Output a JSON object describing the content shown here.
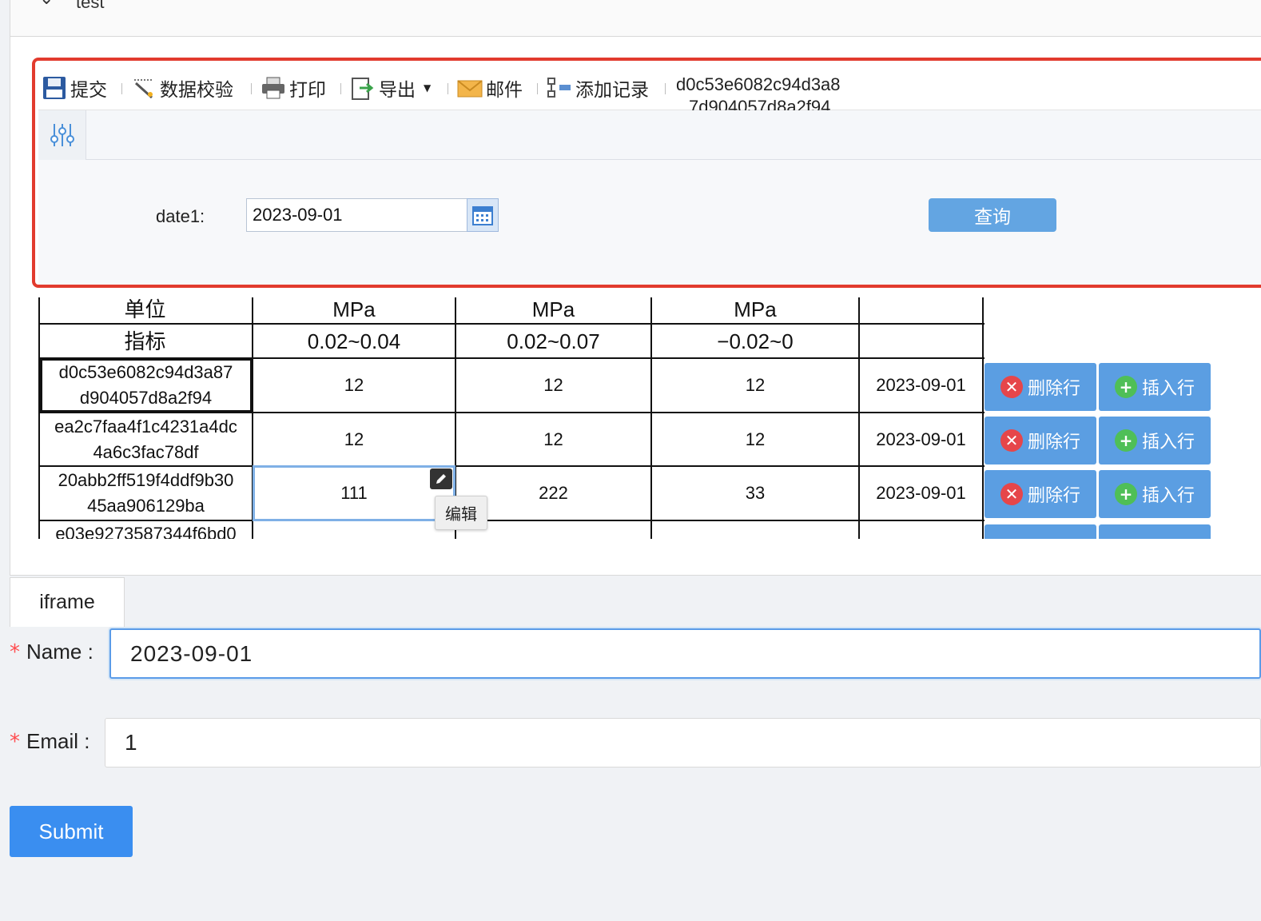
{
  "collapse": {
    "title": "test"
  },
  "toolbar": {
    "submit": "提交",
    "validate": "数据校验",
    "print": "打印",
    "export": "导出",
    "mail": "邮件",
    "add_record": "添加记录",
    "record_id_line1": "d0c53e6082c94d3a8",
    "record_id_line2": "7d904057d8a2f94"
  },
  "query": {
    "date_label": "date1:",
    "date_value": "2023-09-01",
    "search_button": "查询"
  },
  "table": {
    "unit_label": "单位",
    "metric_label": "指标",
    "units": [
      "MPa",
      "MPa",
      "MPa"
    ],
    "ranges": [
      "0.02~0.04",
      "0.02~0.07",
      "−0.02~0"
    ],
    "rows": [
      {
        "id1": "d0c53e6082c94d3a87",
        "id2": "d904057d8a2f94",
        "v1": "12",
        "v2": "12",
        "v3": "12",
        "date": "2023-09-01"
      },
      {
        "id1": "ea2c7faa4f1c4231a4dc",
        "id2": "4a6c3fac78df",
        "v1": "12",
        "v2": "12",
        "v3": "12",
        "date": "2023-09-01"
      },
      {
        "id1": "20abb2ff519f4ddf9b30",
        "id2": "45aa906129ba",
        "v1": "111",
        "v2": "222",
        "v3": "33",
        "date": "2023-09-01"
      },
      {
        "id1": "e03e9273587344f6bd0",
        "id2": "",
        "v1": "",
        "v2": "",
        "v3": "",
        "date": ""
      }
    ],
    "delete_row": "删除行",
    "insert_row": "插入行",
    "edit_tooltip": "编辑"
  },
  "tab": {
    "label": "iframe"
  },
  "form": {
    "name_label": "Name",
    "name_value": "2023-09-01",
    "email_label": "Email",
    "email_value": "1",
    "submit_label": "Submit"
  },
  "colors": {
    "accent": "#3a8ef0",
    "highlight": "#e23b2e",
    "delete": "#e6464a",
    "insert": "#4fbf57"
  }
}
